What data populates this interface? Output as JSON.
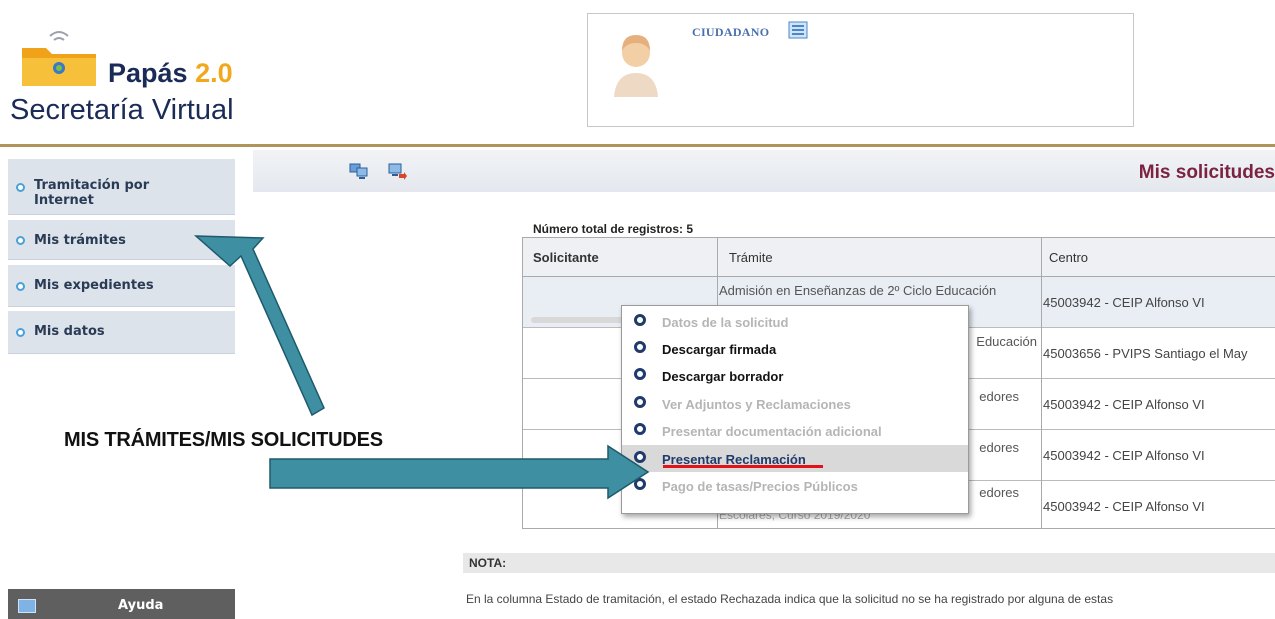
{
  "brand": {
    "name": "Papás",
    "version": "2.0",
    "subtitle": "Secretaría Virtual"
  },
  "user": {
    "role": "CIUDADANO"
  },
  "sidebar": {
    "items": [
      {
        "label": "Tramitación por Internet"
      },
      {
        "label": "Mis trámites"
      },
      {
        "label": "Mis expedientes"
      },
      {
        "label": "Mis datos"
      }
    ],
    "help_label": "Ayuda"
  },
  "page": {
    "title": "Mis solicitudes"
  },
  "table": {
    "total_label": "Número total de registros: 5",
    "headers": [
      "Solicitante",
      "Trámite",
      "Centro"
    ],
    "rows": [
      {
        "tramite": "Admisión en Enseñanzas de 2º Ciclo Educación",
        "centro": "45003942 - CEIP Alfonso VI"
      },
      {
        "tramite": "Educación",
        "centro": "45003656 - PVIPS Santiago el May"
      },
      {
        "tramite": "edores",
        "centro": "45003942 - CEIP Alfonso VI"
      },
      {
        "tramite": "edores",
        "centro": "45003942 - CEIP Alfonso VI"
      },
      {
        "tramite": "edores",
        "tramite_extra": "Escolares, Curso 2019/2020",
        "centro": "45003942 - CEIP Alfonso VI"
      }
    ]
  },
  "context_menu": {
    "items": [
      {
        "label": "Datos de la solicitud",
        "state": "disabled"
      },
      {
        "label": "Descargar firmada",
        "state": "enabled"
      },
      {
        "label": "Descargar borrador",
        "state": "enabled"
      },
      {
        "label": "Ver Adjuntos y Reclamaciones",
        "state": "disabled"
      },
      {
        "label": "Presentar documentación adicional",
        "state": "disabled"
      },
      {
        "label": "Presentar Reclamación",
        "state": "hover"
      },
      {
        "label": "Pago de tasas/Precios Públicos",
        "state": "disabled"
      }
    ]
  },
  "note": {
    "title": "NOTA:",
    "text": "En la columna Estado de tramitación, el estado Rechazada indica que la solicitud no se ha registrado por alguna de estas"
  },
  "annotation": {
    "label": "MIS TRÁMITES/MIS SOLICITUDES",
    "arrow_color": "#3f8fa3"
  },
  "colors": {
    "header_rule": "#b0945c",
    "heading": "#7b2340",
    "sidebar_bg": "#dde3ea",
    "highlight_underline": "#e0131b"
  }
}
